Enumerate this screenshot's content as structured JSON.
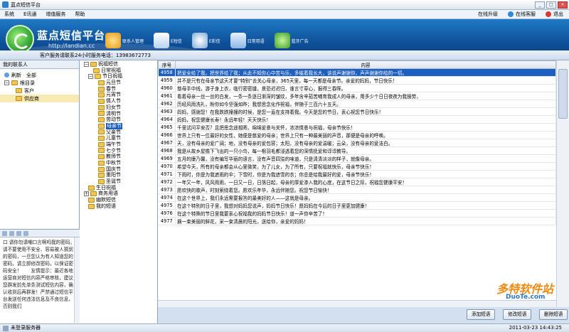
{
  "window": {
    "title": "蓝点短信平台"
  },
  "menu": {
    "items": [
      "系统",
      "E讯通",
      "增值服务",
      "帮助"
    ],
    "right": [
      "在线升级",
      "在线客服",
      "退出"
    ]
  },
  "banner": {
    "brand": "蓝点短信平台",
    "url": "http://landian.cc"
  },
  "toolbar": {
    "buttons": [
      "联系人管理",
      "E短信",
      "E彩信",
      "日常用语",
      "蓝牙广告"
    ]
  },
  "service_line": "客户服务请联系24小时服务电话：13983672773",
  "contacts": {
    "header": "我的联系人",
    "actions": [
      "刷新",
      "全部"
    ],
    "root": "根目录",
    "items": [
      "客户",
      "供应商"
    ]
  },
  "note": {
    "text": "口 请你勿请嘲口言啊吗我的密码，请不要使用不安全、容易被人猜到的密码，一旦您认为有人知道您的密码，请立即修改密码，以保证密码安全！　　友情提示：最近各地运营商对短信内容严格审核，建议您群发前先单条测试短信内容，确认收到后再群发！严禁通过短信平台发送任何违法信息及不良信息，否则我们"
  },
  "categories": {
    "root": "祝福短信",
    "groups": [
      "日常祝福",
      "节日祝福"
    ],
    "festivals": [
      "元旦节",
      "春节",
      "元宵节",
      "情人节",
      "妇女节",
      "清明节",
      "劳动节",
      "母亲节",
      "父亲节",
      "儿童节",
      "端午节",
      "七夕节",
      "教师节",
      "中秋节",
      "国庆节",
      "重阳节",
      "圣诞节"
    ],
    "selected": "母亲节",
    "others": [
      "生日祝福",
      "商务用语",
      "幽默短信",
      "我的短语"
    ]
  },
  "messages": {
    "headers": [
      "序号",
      "内容"
    ],
    "rows": [
      [
        "4958",
        "把爱全给了我，把世界给了我；从此不知你心中苦与乐，多催着我长大，该说声谢谢你，声声谢谢你给的一切。"
      ],
      [
        "4959",
        "并不是只有在母亲节这天才要“特别”去关心母亲，365天里，每一天都是母亲节。亲爱的妈妈，节日快乐！"
      ],
      [
        "4960",
        "慈母手中线，游子身上衣，临行密密缝，意恐迟迟归，谁言寸草心，报得三春晖。"
      ],
      [
        "4961",
        "看着母亲一丝一丝的白发，一条一条逐日渐深的皱纹，多年含辛茹苦哺育我成人的母亲，用多少个日日夜夜为我操劳，"
      ],
      [
        "4962",
        "历经风雨洗礼，盼你如今坚强如昨；我想思念化作祝福，伴随于三百六十五天。"
      ],
      [
        "4963",
        "妈妈，感谢您！在我跌跌撞撞的时候，是您一直在支持着我。今天是您的节日，衷心祝您节日快乐！"
      ],
      [
        "4964",
        "妈妈，祝您健康长寿！永远年轻！天天快乐！"
      ],
      [
        "4965",
        "千里试问平安否？且把思念遥相寄。绵绵爱意与关怀，浓浓情意与祝福，母亲节快乐！"
      ],
      [
        "4966",
        "世界上只有一位最好的女性，她便是慈爱的母亲；世界上只有一种最美丽的声音，那便是母亲的呼唤。"
      ],
      [
        "4967",
        "天，没有母亲的爱广阔；地，没有母亲的爱包容；太阳，没有母亲的爱温暖；云朵，没有母亲的爱洁白。"
      ],
      [
        "4968",
        "我是从故乡屋檐下飞出的一只小鸟，每一根羽毛都浸透着您的深情抚爱和谆谆教导。"
      ],
      [
        "4969",
        "五月的康乃馨，没有编写华丽的语言，没有声音四溢的味道，只是清清淡淡的样子，就像母亲。"
      ],
      [
        "4970",
        "希望今天，所有的母亲都会从心里微笑，为了儿女，为了所有，只要祝福就快乐，母亲节快乐！"
      ],
      [
        "4971",
        "下雨时，你是为我遮雨的伞；下雪时，你是为我遮雪的衣；你总是给我最好的爱，母亲节快乐！"
      ],
      [
        "4972",
        "一年又一年，风风雨雨，一日又一日，日落日起，母亲的厚爱渗入我的心底，在这节日之际，祝福您健康平安！"
      ],
      [
        "4973",
        "愿欢快的歌声，时刻萦绕着您。愿欢乐年华，永远伴随您。祝您节日愉快！"
      ],
      [
        "4974",
        "在这个世界上，我们永远需要报答的最美好的人——这就是母亲。"
      ],
      [
        "4975",
        "在这个特别的日子里，我想对妈妈您说声，妈妈节日快乐！愿妈妈在今后的日子里更加健康！"
      ],
      [
        "4976",
        "在这个特殊的节日里我要衷心祝福我的妈妈节日快乐！道一声你辛苦了！"
      ],
      [
        "4977",
        "摘一束美丽的鲜花，采一束清晨的阳光，送给你，亲爱的妈妈！"
      ]
    ],
    "highlighted_row": "4958"
  },
  "actions": [
    "添加短语",
    "修改短语",
    "删除短语"
  ],
  "status": {
    "left": "未登录服务器",
    "right": "2011-03-23  14:43:25"
  },
  "watermark": {
    "main": "多特软件站",
    "sub": "DuoTe.com"
  }
}
